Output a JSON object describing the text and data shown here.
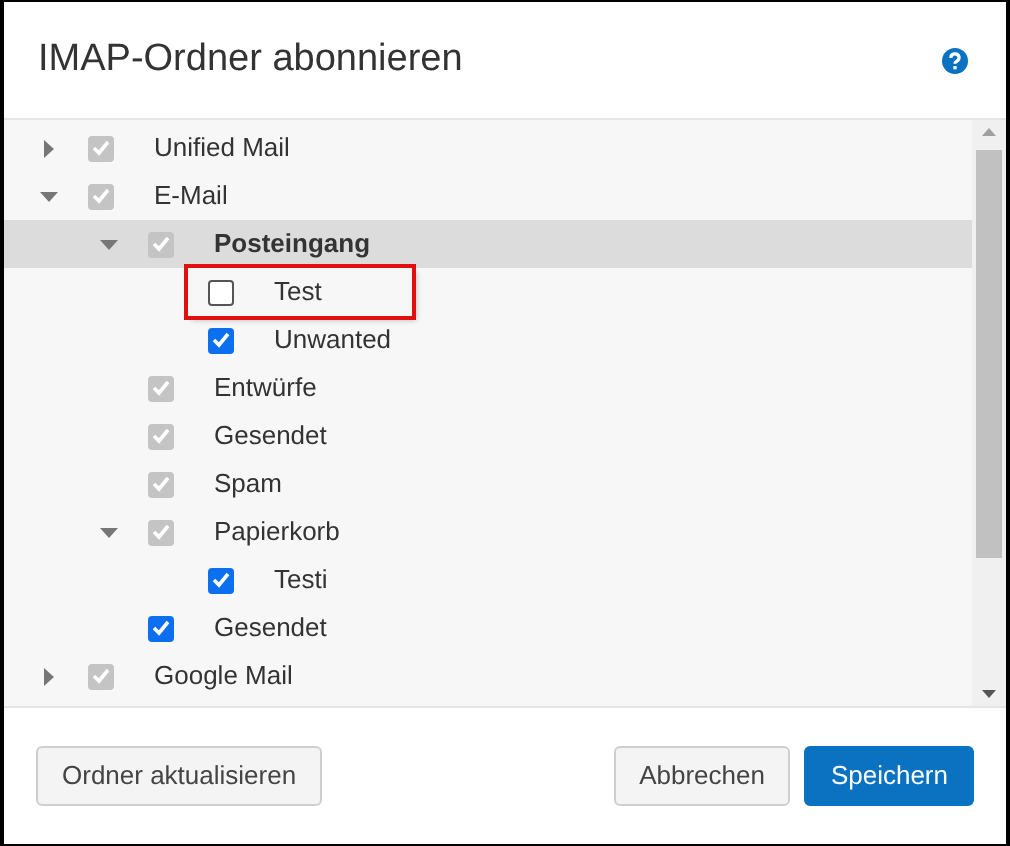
{
  "dialog": {
    "title": "IMAP-Ordner abonnieren"
  },
  "tree": [
    {
      "label": "Unified Mail",
      "checked": true,
      "disabled": true,
      "expanded": false,
      "selected": false,
      "highlighted": false
    },
    {
      "label": "E-Mail",
      "checked": true,
      "disabled": true,
      "expanded": true,
      "selected": false,
      "highlighted": false,
      "children": [
        {
          "label": "Posteingang",
          "checked": true,
          "disabled": true,
          "expanded": true,
          "selected": true,
          "highlighted": false,
          "children": [
            {
              "label": "Test",
              "checked": false,
              "disabled": false,
              "selected": false,
              "highlighted": true
            },
            {
              "label": "Unwanted",
              "checked": true,
              "disabled": false,
              "selected": false,
              "highlighted": false
            }
          ]
        },
        {
          "label": "Entwürfe",
          "checked": true,
          "disabled": true,
          "selected": false,
          "highlighted": false
        },
        {
          "label": "Gesendet",
          "checked": true,
          "disabled": true,
          "selected": false,
          "highlighted": false
        },
        {
          "label": "Spam",
          "checked": true,
          "disabled": true,
          "selected": false,
          "highlighted": false
        },
        {
          "label": "Papierkorb",
          "checked": true,
          "disabled": true,
          "expanded": true,
          "selected": false,
          "highlighted": false,
          "children": [
            {
              "label": "Testi",
              "checked": true,
              "disabled": false,
              "selected": false,
              "highlighted": false
            }
          ]
        },
        {
          "label": "Gesendet",
          "checked": true,
          "disabled": false,
          "selected": false,
          "highlighted": false
        }
      ]
    },
    {
      "label": "Google Mail",
      "checked": true,
      "disabled": true,
      "expanded": false,
      "selected": false,
      "highlighted": false
    }
  ],
  "buttons": [
    {
      "label": "Ordner aktualisieren",
      "kind": "secondary"
    },
    {
      "label": "Abbrechen",
      "kind": "secondary"
    },
    {
      "label": "Speichern",
      "kind": "primary"
    }
  ]
}
